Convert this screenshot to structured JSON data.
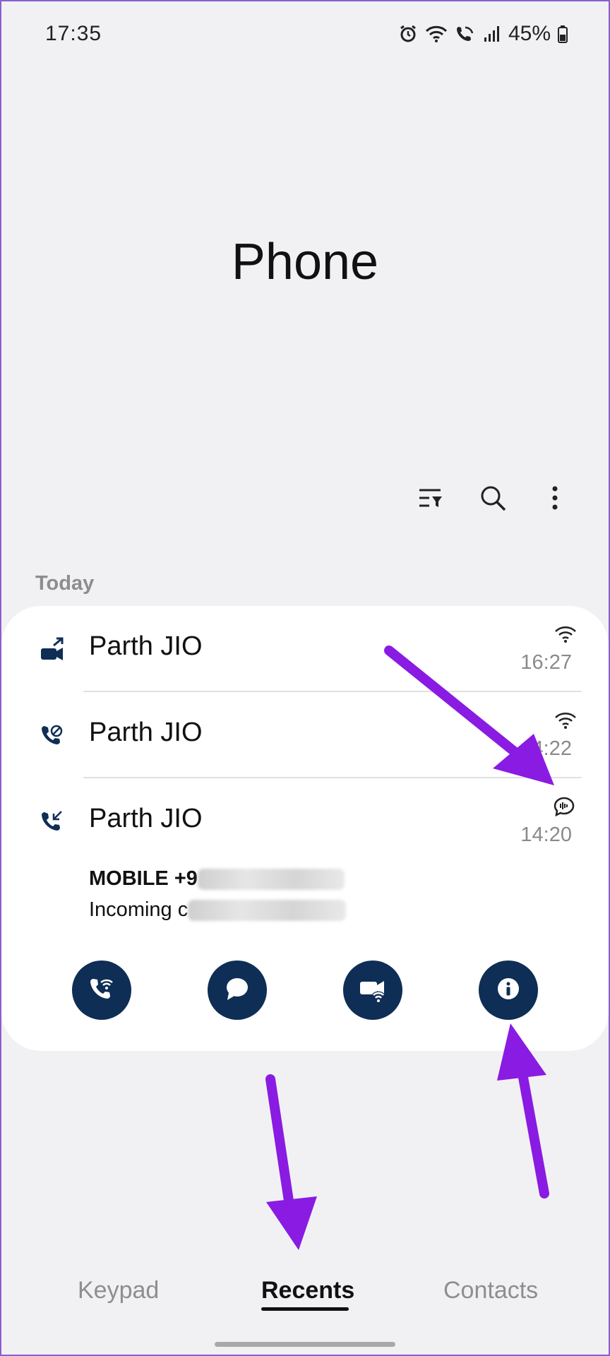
{
  "status_bar": {
    "time": "17:35",
    "battery": "45%"
  },
  "header": {
    "title": "Phone"
  },
  "toolbar": {
    "icons": [
      "filter-icon",
      "search-icon",
      "more-options-icon"
    ]
  },
  "section": {
    "label": "Today"
  },
  "calls": [
    {
      "name": "Parth JIO",
      "time": "16:27",
      "call_icon": "video-call-outgoing-icon",
      "type_icon": "wifi-calling-icon"
    },
    {
      "name": "Parth JIO",
      "time": "14:22",
      "call_icon": "missed-call-icon",
      "type_icon": "wifi-calling-icon"
    },
    {
      "name": "Parth JIO",
      "time": "14:20",
      "call_icon": "incoming-call-icon",
      "type_icon": "call-recording-icon"
    }
  ],
  "expanded": {
    "number_label": "MOBILE +9",
    "status_label": "Incoming c",
    "actions": [
      "voice-call",
      "message",
      "video-call",
      "details"
    ]
  },
  "nav": {
    "keypad": "Keypad",
    "recents": "Recents",
    "contacts": "Contacts",
    "active": "recents"
  },
  "colors": {
    "accent": "#0e2e55",
    "annotation_arrow": "#8a1be2",
    "card": "#ffffff",
    "background": "#f1f1f3"
  }
}
